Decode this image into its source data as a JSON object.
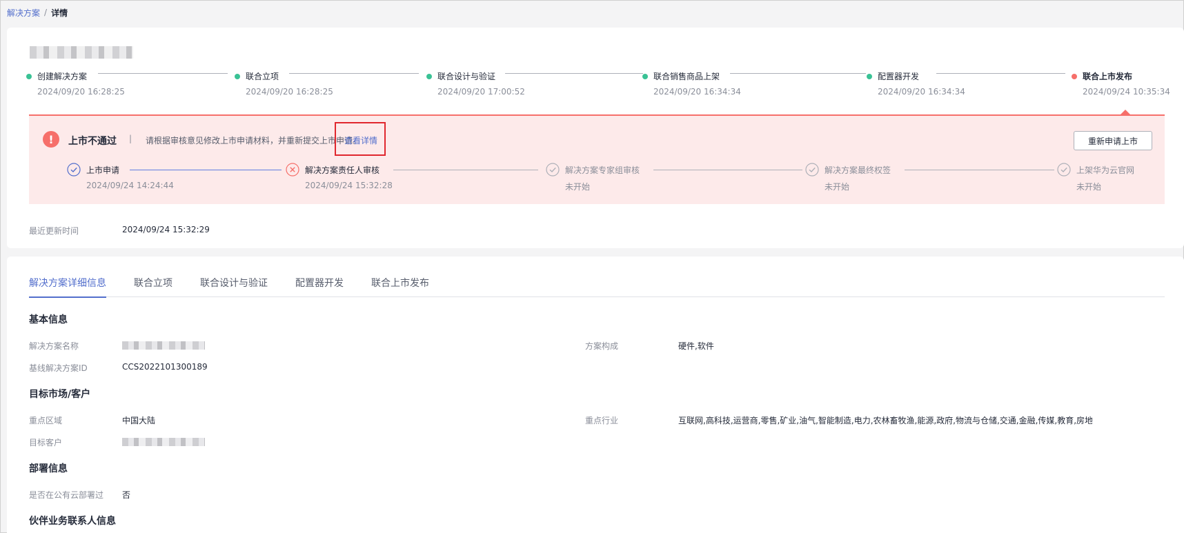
{
  "breadcrumb": {
    "parent": "解决方案",
    "separator": "/",
    "current": "详情"
  },
  "steps": [
    {
      "name": "创建解决方案",
      "time": "2024/09/20 16:28:25",
      "status": "done"
    },
    {
      "name": "联合立项",
      "time": "2024/09/20 16:28:25",
      "status": "done"
    },
    {
      "name": "联合设计与验证",
      "time": "2024/09/20 17:00:52",
      "status": "done"
    },
    {
      "name": "联合销售商品上架",
      "time": "2024/09/20 16:34:34",
      "status": "done"
    },
    {
      "name": "配置器开发",
      "time": "2024/09/20 16:34:34",
      "status": "done"
    },
    {
      "name": "联合上市发布",
      "time": "2024/09/24 10:35:34",
      "status": "current"
    }
  ],
  "alert": {
    "icon": "!",
    "title": "上市不通过",
    "divider": "|",
    "message": "请根据审核意见修改上市申请材料，并重新提交上市申请。",
    "link": "查看详情",
    "button": "重新申请上市"
  },
  "sub_steps": [
    {
      "name": "上市申请",
      "time": "2024/09/24 14:24:44",
      "status": "done"
    },
    {
      "name": "解决方案责任人审核",
      "time": "2024/09/24 15:32:28",
      "status": "rejected"
    },
    {
      "name": "解决方案专家组审核",
      "time": "未开始",
      "status": "pending"
    },
    {
      "name": "解决方案最终权签",
      "time": "未开始",
      "status": "pending"
    },
    {
      "name": "上架华为云官网",
      "time": "未开始",
      "status": "pending"
    }
  ],
  "updated": {
    "label": "最近更新时间",
    "value": "2024/09/24 15:32:29"
  },
  "tabs": [
    "解决方案详细信息",
    "联合立项",
    "联合设计与验证",
    "配置器开发",
    "联合上市发布"
  ],
  "sections": {
    "basic": {
      "title": "基本信息",
      "name_label": "解决方案名称",
      "composition_label": "方案构成",
      "composition_value": "硬件,软件",
      "baseline_label": "基线解决方案ID",
      "baseline_value": "CCS2022101300189"
    },
    "market": {
      "title": "目标市场/客户",
      "region_label": "重点区域",
      "region_value": "中国大陆",
      "industry_label": "重点行业",
      "industry_value": "互联网,高科技,运营商,零售,矿业,油气,智能制造,电力,农林畜牧渔,能源,政府,物流与仓储,交通,金融,传媒,教育,房地产",
      "customer_label": "目标客户"
    },
    "deploy": {
      "title": "部署信息",
      "public_label": "是否在公有云部署过",
      "public_value": "否"
    },
    "contact": {
      "title": "伙伴业务联系人信息"
    }
  },
  "colors": {
    "accent": "#526ecc",
    "success": "#3ac295",
    "danger": "#f66f6a",
    "alert_bg": "#fdeaea"
  }
}
